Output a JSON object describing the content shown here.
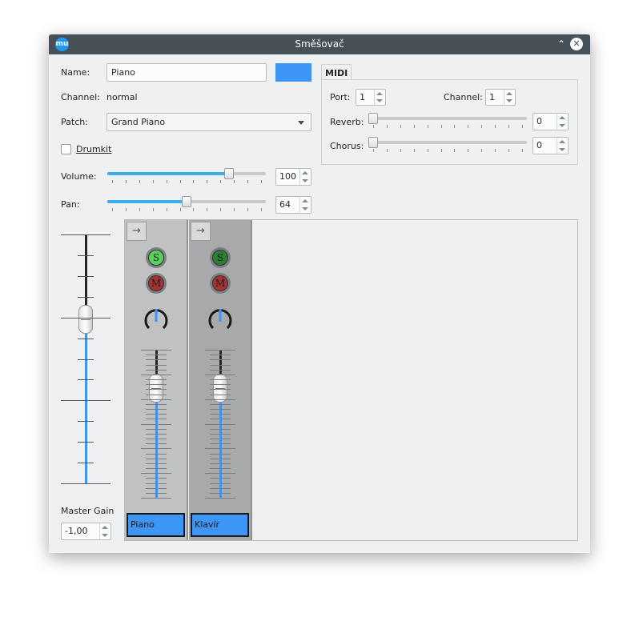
{
  "window": {
    "title": "Směšovač",
    "app_icon": "mu",
    "icons": {
      "maximize": "chevron-up-icon",
      "close": "close-icon"
    }
  },
  "channel_form": {
    "name_label": "Name:",
    "name_value": "Piano",
    "color": "#3d95f5",
    "channel_label": "Channel:",
    "channel_value": "normal",
    "patch_label": "Patch:",
    "patch_value": "Grand Piano",
    "drumkit_label": "Drumkit",
    "drumkit_checked": false,
    "volume_label": "Volume:",
    "volume_value": "100",
    "volume_max": 127,
    "pan_label": "Pan:",
    "pan_value": "64",
    "pan_max": 128
  },
  "midi": {
    "tab_label": "MIDI",
    "port_label": "Port:",
    "port_value": "1",
    "channel_label": "Channel:",
    "channel_value": "1",
    "reverb_label": "Reverb:",
    "reverb_value": "0",
    "chorus_label": "Chorus:",
    "chorus_value": "0"
  },
  "master": {
    "gain_label": "Master Gain",
    "gain_value": "-1,00",
    "level_fraction": 0.68
  },
  "strips": [
    {
      "name": "Piano",
      "solo_label": "S",
      "mute_label": "M",
      "solo_on": true,
      "level_fraction": 0.8
    },
    {
      "name": "Klavír",
      "solo_label": "S",
      "mute_label": "M",
      "solo_on": false,
      "level_fraction": 0.8
    }
  ],
  "colors": {
    "accent": "#3daee9",
    "strip_color": "#3d95f5",
    "titlebar": "#475057",
    "solo_on": "#58d25a",
    "solo_off": "#2b7e34",
    "mute": "#a73331"
  }
}
